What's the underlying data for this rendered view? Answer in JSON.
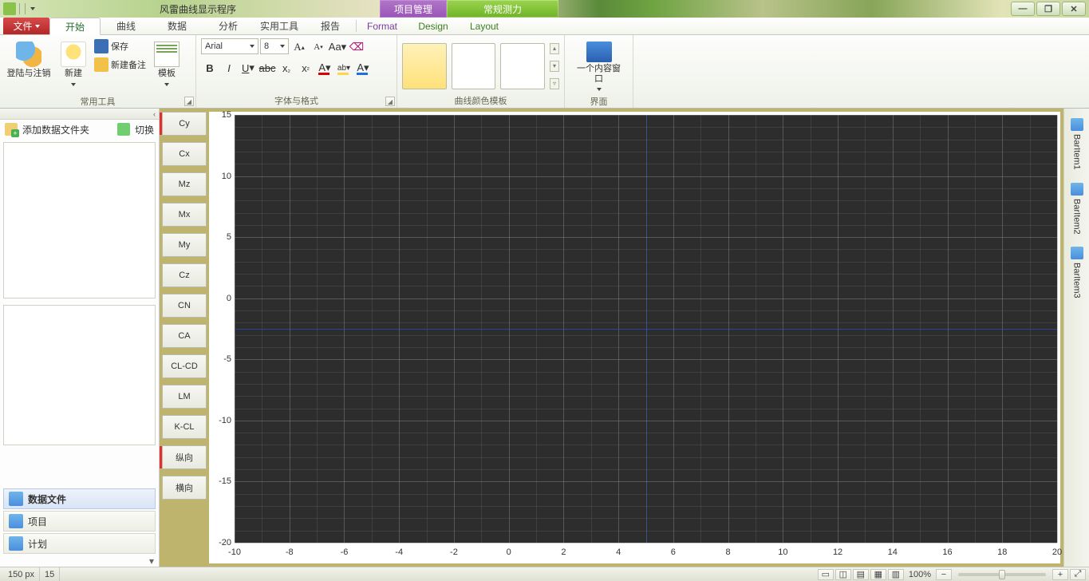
{
  "app_title": "风雷曲线显示程序",
  "context_tabs": {
    "project": "项目管理",
    "routine": "常规测力"
  },
  "window_controls": {
    "min": "—",
    "max": "❐",
    "close": "✕"
  },
  "file_tab": "文件",
  "tabs": [
    "开始",
    "曲线",
    "数据",
    "分析",
    "实用工具",
    "报告"
  ],
  "ctx_sub": [
    "Format",
    "Design",
    "Layout"
  ],
  "ribbon": {
    "group_common": {
      "title": "常用工具",
      "login": "登陆与注销",
      "new": "新建",
      "save": "保存",
      "memo": "新建备注",
      "template": "模板"
    },
    "group_font": {
      "title": "字体与格式",
      "font_name": "Arial",
      "font_size": "8"
    },
    "group_colors": {
      "title": "曲线颜色模板"
    },
    "group_interface": {
      "title": "界面",
      "single_window": "一个内容窗口"
    }
  },
  "left_panel": {
    "add_folder": "添加数据文件夹",
    "switch": "切换",
    "sections": {
      "data_files": "数据文件",
      "project": "项目",
      "plan": "计划"
    }
  },
  "axis_buttons": [
    "Cy",
    "Cx",
    "Mz",
    "Mx",
    "My",
    "Cz",
    "CN",
    "CA",
    "CL-CD",
    "LM",
    "K-CL",
    "纵向",
    "横向"
  ],
  "right_dock": [
    "BarItem1",
    "BarItem2",
    "BarItem3"
  ],
  "status": {
    "left1": "150 px",
    "left2": "15",
    "zoom": "100%"
  },
  "chart_data": {
    "type": "line",
    "title": "",
    "xlabel": "",
    "ylabel": "",
    "xlim": [
      -10,
      20
    ],
    "ylim": [
      -20,
      15
    ],
    "xticks": [
      -10,
      -8,
      -6,
      -4,
      -2,
      0,
      2,
      4,
      6,
      8,
      10,
      12,
      14,
      16,
      18,
      20
    ],
    "yticks": [
      -20,
      -15,
      -10,
      -5,
      0,
      5,
      10,
      15
    ],
    "series": []
  }
}
